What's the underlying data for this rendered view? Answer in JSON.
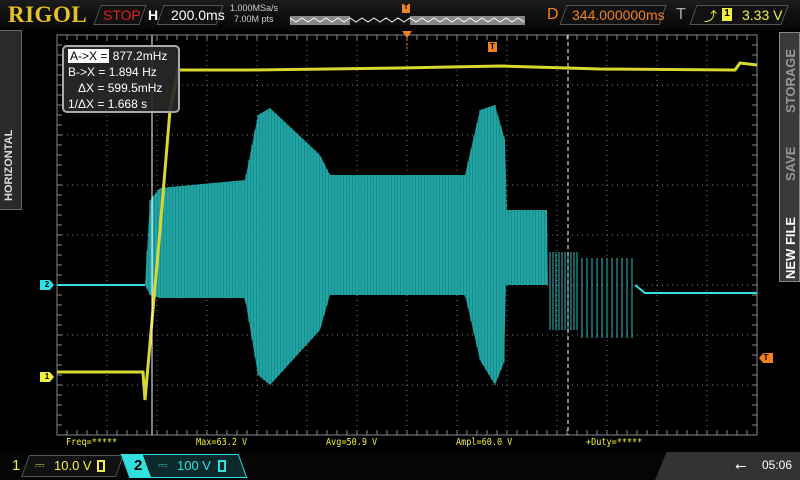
{
  "header": {
    "brand": "RIGOL",
    "run_state": "STOP",
    "timebase_label": "H",
    "timebase": "200.0ms",
    "sample_rate": "1.000MSa/s",
    "memory_depth": "7.00M pts",
    "delay_label": "D",
    "delay": "344.000000ms",
    "trigger_label": "T",
    "trigger_source": "1",
    "trigger_level": "3.33 V"
  },
  "left_menu": {
    "label": "HORIZONTAL"
  },
  "right_menu": {
    "items": [
      "STORAGE",
      "SAVE",
      "NEW FILE"
    ]
  },
  "cursor_box": {
    "rows": [
      {
        "label": "A->X =",
        "value": "877.2mHz"
      },
      {
        "label": "B->X =",
        "value": "1.894 Hz"
      },
      {
        "label": "ΔX =",
        "value": "599.5mHz"
      },
      {
        "label": "1/ΔX =",
        "value": "1.668 s"
      }
    ]
  },
  "measurements": [
    "Freq=*****",
    "Max=63.2 V",
    "Avg=50.9 V",
    "Ampl=60.0 V",
    "+Duty=*****"
  ],
  "channels": [
    {
      "num": "1",
      "scale": "10.0 V",
      "color": "#f0f040"
    },
    {
      "num": "2",
      "scale": "100 V",
      "color": "#30e0e0"
    }
  ],
  "markers": {
    "ch1": "1",
    "ch2": "2",
    "trigger": "T"
  },
  "status": {
    "time": "05:06"
  }
}
